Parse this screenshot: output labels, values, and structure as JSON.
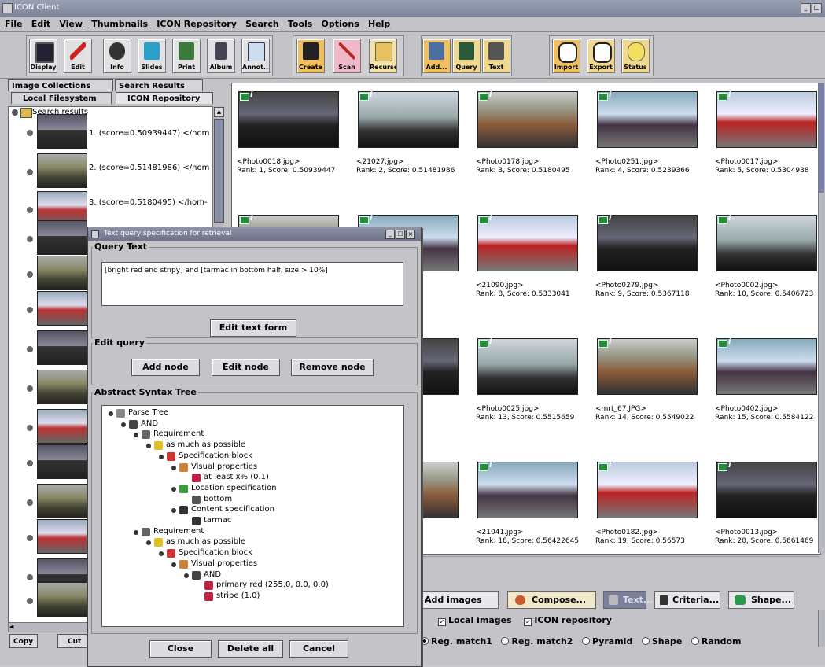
{
  "window": {
    "title": "ICON Client"
  },
  "menu": [
    "File",
    "Edit",
    "View",
    "Thumbnails",
    "ICON Repository",
    "Search",
    "Tools",
    "Options",
    "Help"
  ],
  "toolbar": [
    {
      "label": "Display",
      "icon": "display-icon"
    },
    {
      "label": "Edit",
      "icon": "scissors-icon"
    },
    {
      "label": "Info",
      "icon": "info-icon"
    },
    {
      "label": "Slides",
      "icon": "slides-icon"
    },
    {
      "label": "Print",
      "icon": "printer-icon"
    },
    {
      "label": "Album",
      "icon": "album-icon"
    },
    {
      "label": "Annot...",
      "icon": "annotate-icon"
    },
    {
      "label": "Create",
      "icon": "film-icon"
    },
    {
      "label": "Scan",
      "icon": "scan-icon"
    },
    {
      "label": "Recurse",
      "icon": "folder-icon"
    },
    {
      "label": "Add...",
      "icon": "add-icon"
    },
    {
      "label": "Query",
      "icon": "query-icon"
    },
    {
      "label": "Text",
      "icon": "text-icon"
    },
    {
      "label": "Import",
      "icon": "binoculars-icon"
    },
    {
      "label": "Export",
      "icon": "binoculars-icon"
    },
    {
      "label": "Status",
      "icon": "bulb-icon"
    }
  ],
  "left_tabs": {
    "image_collections": "Image Collections",
    "search_results": "Search Results",
    "local_filesystem": "Local Filesystem",
    "icon_repository": "ICON Repository"
  },
  "tree": {
    "root": "Search results",
    "results": [
      "1. (score=0.50939447) </hom",
      "2. (score=0.51481986) </hom",
      "3. (score=0.5180495) </hom-"
    ]
  },
  "left_bottom": {
    "copy": "Copy",
    "cut": "Cut"
  },
  "grid": [
    {
      "name": "<Photo0018.jpg>",
      "rank": "Rank: 1, Score: 0.50939447"
    },
    {
      "name": "<21027.jpg>",
      "rank": "Rank: 2, Score: 0.51481986"
    },
    {
      "name": "<Photo0178.jpg>",
      "rank": "Rank: 3, Score: 0.5180495"
    },
    {
      "name": "<Photo0251.jpg>",
      "rank": "Rank: 4, Score: 0.5239366"
    },
    {
      "name": "<Photo0017.jpg>",
      "rank": "Rank: 5, Score: 0.5304938"
    },
    {
      "name": "",
      "rank": "5327151"
    },
    {
      "name": "",
      "rank": ""
    },
    {
      "name": "<21090.jpg>",
      "rank": "Rank: 8, Score: 0.5333041"
    },
    {
      "name": "<Photo0279.jpg>",
      "rank": "Rank: 9, Score: 0.5367118"
    },
    {
      "name": "<Photo0002.jpg>",
      "rank": "Rank: 10, Score: 0.5406723"
    },
    {
      "name": "",
      "rank": "54515225"
    },
    {
      "name": "",
      "rank": ""
    },
    {
      "name": "<Photo0025.jpg>",
      "rank": "Rank: 13, Score: 0.5515659"
    },
    {
      "name": "<mrt_67.JPG>",
      "rank": "Rank: 14, Score: 0.5549022"
    },
    {
      "name": "<Photo0402.jpg>",
      "rank": "Rank: 15, Score: 0.5584122"
    },
    {
      "name": "",
      "rank": "5593574"
    },
    {
      "name": "",
      "rank": ""
    },
    {
      "name": "<21041.jpg>",
      "rank": "Rank: 18, Score: 0.56422645"
    },
    {
      "name": "<Photo0182.jpg>",
      "rank": "Rank: 19, Score: 0.56573"
    },
    {
      "name": "<Photo0013.jpg>",
      "rank": "Rank: 20, Score: 0.5661469"
    }
  ],
  "bottom_buttons": {
    "add_images": "Add images",
    "compose": "Compose...",
    "text": "Text...",
    "criteria": "Criteria...",
    "shape": "Shape..."
  },
  "sources": {
    "local": "Local images",
    "icon": "ICON repository"
  },
  "methods": [
    "Reg. match1",
    "Reg. match2",
    "Pyramid",
    "Shape",
    "Random"
  ],
  "dialog": {
    "title": "Text query specification for retrieval",
    "query_text_label": "Query Text",
    "query_text": "[bright red and stripy] and [tarmac in bottom half, size > 10%]",
    "edit_text_form": "Edit text form",
    "edit_query_label": "Edit query",
    "add_node": "Add node",
    "edit_node": "Edit node",
    "remove_node": "Remove node",
    "ast_label": "Abstract Syntax Tree",
    "close": "Close",
    "delete_all": "Delete all",
    "cancel": "Cancel",
    "tree": [
      "Parse Tree",
      "AND",
      "Requirement",
      "as much as possible",
      "Specification block",
      "Visual properties",
      "at least x% (0.1)",
      "Location specification",
      "bottom",
      "Content specification",
      "tarmac",
      "Requirement",
      "as much as possible",
      "Specification block",
      "Visual properties",
      "AND",
      "primary red (255.0, 0.0, 0.0)",
      "stripe (1.0)"
    ]
  }
}
